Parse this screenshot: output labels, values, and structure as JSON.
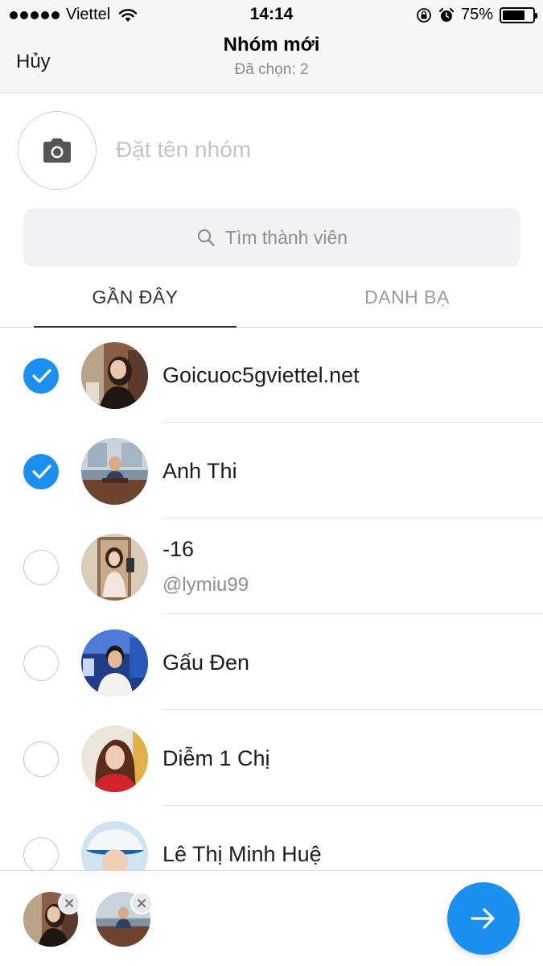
{
  "status_bar": {
    "carrier": "Viettel",
    "time": "14:14",
    "battery_percent": "75%",
    "battery_level": 0.75
  },
  "nav": {
    "cancel_label": "Hủy",
    "title": "Nhóm mới",
    "subtitle": "Đã chọn: 2"
  },
  "group": {
    "name_placeholder": "Đặt tên nhóm",
    "photo_icon": "camera-icon"
  },
  "search": {
    "placeholder": "Tìm thành viên",
    "icon": "search-icon"
  },
  "tabs": [
    {
      "label": "GẦN ĐÂY",
      "active": true
    },
    {
      "label": "DANH BẠ",
      "active": false
    }
  ],
  "contacts": [
    {
      "name": "Goicuoc5gviettel.net",
      "handle": "",
      "selected": true
    },
    {
      "name": "Anh Thi",
      "handle": "",
      "selected": true
    },
    {
      "name": "-16",
      "handle": "@lymiu99",
      "selected": false
    },
    {
      "name": "Gấu Đen",
      "handle": "",
      "selected": false
    },
    {
      "name": "Diễm 1 Chị",
      "handle": "",
      "selected": false
    },
    {
      "name": "Lê Thị Minh Huệ",
      "handle": "",
      "selected": false
    }
  ],
  "colors": {
    "accent": "#1b8ff0",
    "muted_text": "#8e8e93",
    "bar_background": "#f7f7f7"
  }
}
